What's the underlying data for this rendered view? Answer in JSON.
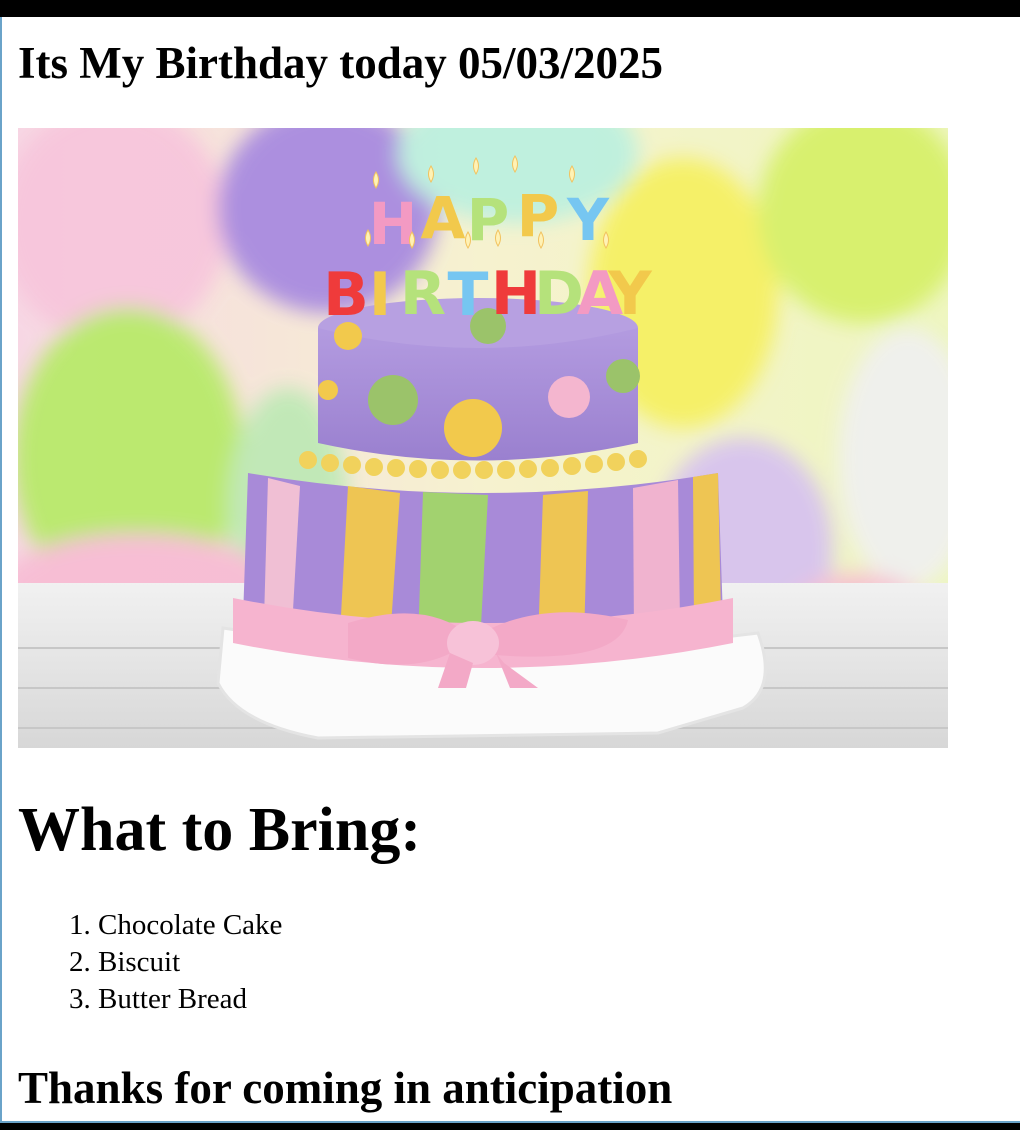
{
  "header": {
    "title": "Its My Birthday today 05/03/2025"
  },
  "image": {
    "candles_row1": "HAPPY",
    "candles_row2": "BIRTHDAY"
  },
  "section": {
    "heading": "What to Bring:"
  },
  "items": [
    "Chocolate Cake",
    "Biscuit",
    "Butter Bread"
  ],
  "footer": {
    "thanks": "Thanks for coming in anticipation"
  },
  "colors": {
    "cake_purple": "#a58ad6",
    "cake_yellow": "#f2c94c",
    "cake_green": "#9fd36b",
    "cake_pink": "#f6b4cf"
  }
}
